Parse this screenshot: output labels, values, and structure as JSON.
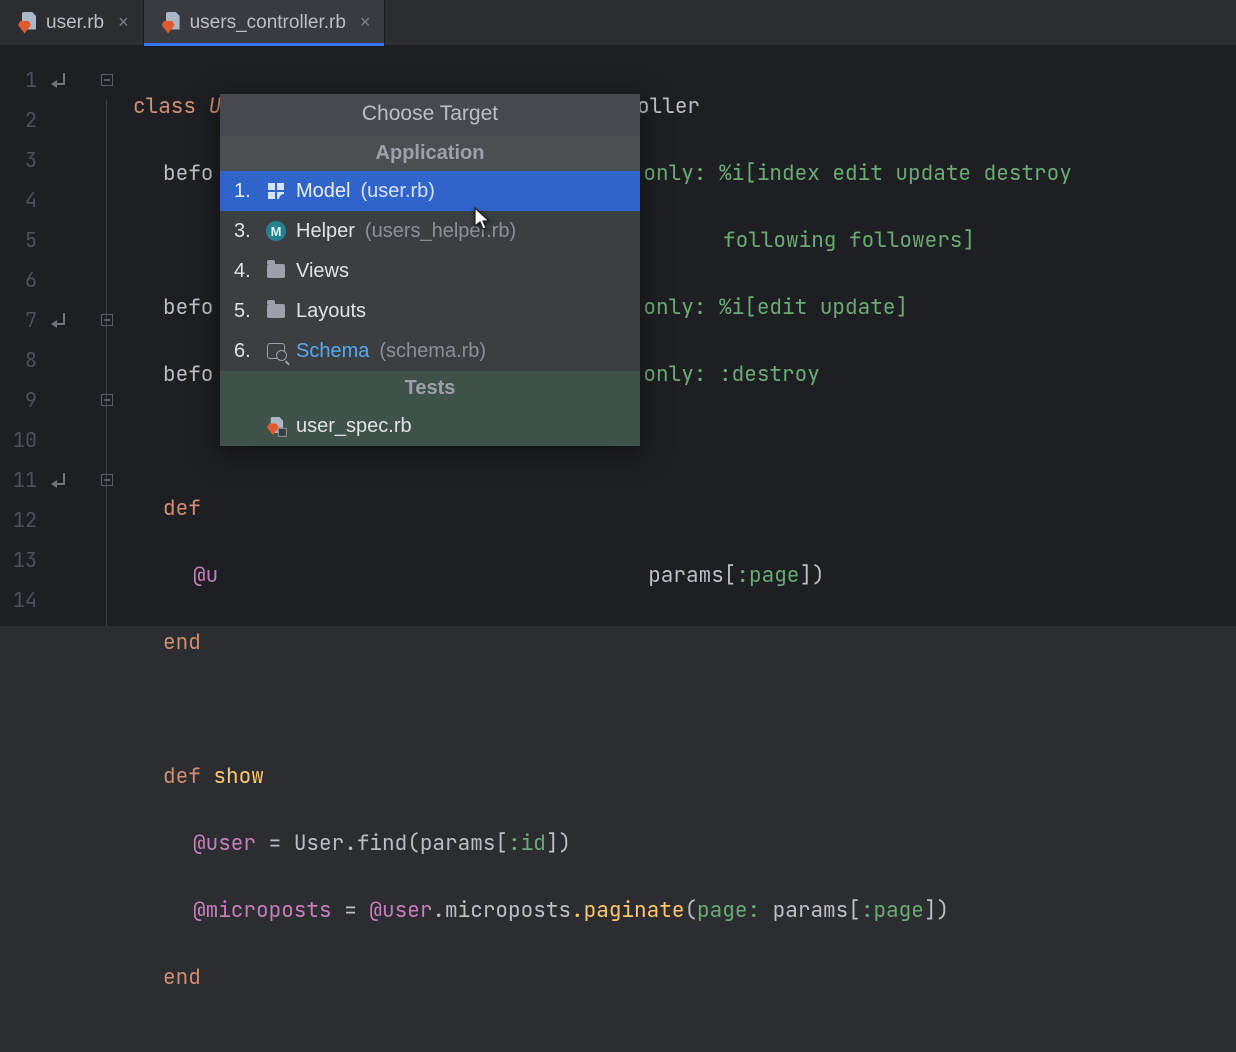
{
  "tabs": [
    {
      "label": "user.rb",
      "active": false
    },
    {
      "label": "users_controller.rb",
      "active": true
    }
  ],
  "gutter": [
    "1",
    "2",
    "3",
    "4",
    "5",
    "6",
    "7",
    "8",
    "9",
    "10",
    "11",
    "12",
    "13",
    "14"
  ],
  "code": {
    "l1": {
      "kw": "class",
      "name": "UsersController",
      "op": "<",
      "base": "ApplicationController"
    },
    "l2a": "befo",
    "l2b_only": "only: ",
    "l2b_arr": "%i[index edit update destroy",
    "l3_arr": "following followers]",
    "l4a": "befo",
    "l4b_only": "only: ",
    "l4b_arr": "%i[edit update]",
    "l5a": "befo",
    "l5b_only": "only: ",
    "l5b_sym": ":destroy",
    "l7": {
      "kw": "def"
    },
    "l8": {
      "inst": "@u",
      "tail": "params[",
      "sym": ":page",
      "close": "])"
    },
    "l9": {
      "kw": "end"
    },
    "l11": {
      "kw": "def",
      "name": "show"
    },
    "l12": {
      "inst": "@user",
      "eq": " = ",
      "const": "User",
      "m1": ".find(params[",
      "sym": ":id",
      "close": "])"
    },
    "l13": {
      "inst": "@microposts",
      "eq": " = ",
      "inst2": "@user",
      "m1": ".microposts",
      "m2": ".paginate",
      "args_open": "(",
      "k1": "page: ",
      "tail": "params[",
      "sym": ":page",
      "close": "])"
    },
    "l14": {
      "kw": "end"
    }
  },
  "popup": {
    "title": "Choose Target",
    "section_app": "Application",
    "section_tests": "Tests",
    "items": [
      {
        "num": "1.",
        "label": "Model",
        "hint": "(user.rb)"
      },
      {
        "num": "3.",
        "label": "Helper",
        "hint": "(users_helper.rb)"
      },
      {
        "num": "4.",
        "label": "Views",
        "hint": ""
      },
      {
        "num": "5.",
        "label": "Layouts",
        "hint": ""
      },
      {
        "num": "6.",
        "label": "Schema",
        "hint": "(schema.rb)"
      }
    ],
    "test_item": {
      "label": "user_spec.rb"
    }
  }
}
